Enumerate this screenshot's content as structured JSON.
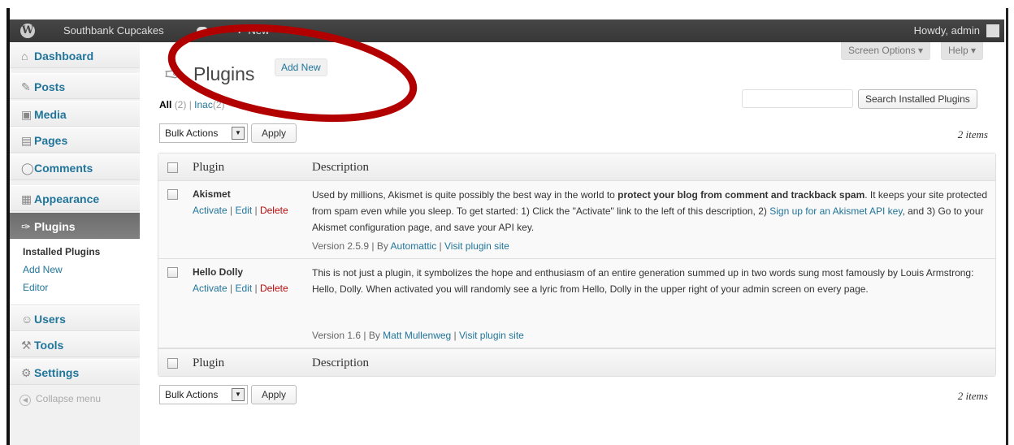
{
  "admin_bar": {
    "site_name": "Southbank Cupcakes",
    "new_label": "New",
    "howdy": "Howdy, admin"
  },
  "sidebar": {
    "items": [
      {
        "label": "Dashboard",
        "icon": "home-icon"
      },
      {
        "label": "Posts",
        "icon": "pushpin-icon"
      },
      {
        "label": "Media",
        "icon": "media-icon"
      },
      {
        "label": "Pages",
        "icon": "page-icon"
      },
      {
        "label": "Comments",
        "icon": "comment-icon"
      },
      {
        "label": "Appearance",
        "icon": "appearance-icon"
      },
      {
        "label": "Plugins",
        "icon": "plug-icon"
      },
      {
        "label": "Users",
        "icon": "users-icon"
      },
      {
        "label": "Tools",
        "icon": "tools-icon"
      },
      {
        "label": "Settings",
        "icon": "settings-icon"
      }
    ],
    "submenu": [
      "Installed Plugins",
      "Add New",
      "Editor"
    ],
    "collapse": "Collapse menu"
  },
  "header": {
    "screen_options": "Screen Options ▾",
    "help": "Help ▾",
    "title": "Plugins",
    "add_new": "Add New"
  },
  "filters": {
    "all_label": "All",
    "all_count": "(2)",
    "sep": "|",
    "inactive_label": "Inac",
    "inactive_count": "(2)"
  },
  "search": {
    "button": "Search Installed Plugins"
  },
  "bulk": {
    "label": "Bulk Actions",
    "apply": "Apply",
    "count": "2 items"
  },
  "table": {
    "col_plugin": "Plugin",
    "col_description": "Description",
    "rows": [
      {
        "name": "Akismet",
        "actions": [
          "Activate",
          "Edit",
          "Delete"
        ],
        "desc_1": "Used by millions, Akismet is quite possibly the best way in the world to ",
        "desc_bold": "protect your blog from comment and trackback spam",
        "desc_2": ". It keeps your site protected from spam even while you sleep. To get started: 1) Click the \"Activate\" link to the left of this description, 2) ",
        "desc_link": "Sign up for an Akismet API key",
        "desc_3": ", and 3) Go to your Akismet configuration page, and save your API key.",
        "version": "Version 2.5.9 | By ",
        "author": "Automattic",
        "visit": "Visit plugin site"
      },
      {
        "name": "Hello Dolly",
        "actions": [
          "Activate",
          "Edit",
          "Delete"
        ],
        "desc": "This is not just a plugin, it symbolizes the hope and enthusiasm of an entire generation summed up in two words sung most famously by Louis Armstrong: Hello, Dolly. When activated you will randomly see a lyric from Hello, Dolly in the upper right of your admin screen on every page.",
        "version": "Version 1.6 | By ",
        "author": "Matt Mullenweg",
        "visit": "Visit plugin site"
      }
    ]
  },
  "colors": {
    "link": "#21759b",
    "delete": "#bc0b0b",
    "admin_bar": "#464646",
    "annotation": "#b20000"
  }
}
